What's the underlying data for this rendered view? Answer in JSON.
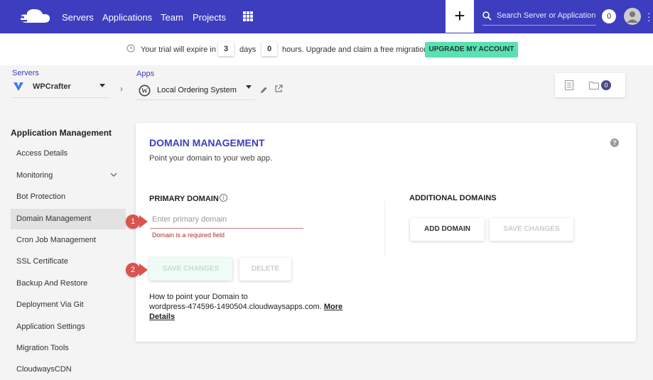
{
  "nav": {
    "links": [
      "Servers",
      "Applications",
      "Team",
      "Projects"
    ],
    "plus_label": "+",
    "search_placeholder": "Search Server or Application",
    "notif_count": "0",
    "brand_color": "#3d3dbf"
  },
  "trial": {
    "text1": "Your trial will expire in",
    "days": "3",
    "text2": "days",
    "hours": "0",
    "text3": "hours. Upgrade and claim a free migration",
    "upgrade_label": "UPGRADE MY ACCOUNT"
  },
  "crumbs": {
    "servers_label": "Servers",
    "server_name": "WPCrafter",
    "apps_label": "Apps",
    "app_name": "Local Ordering System"
  },
  "files_count": "0",
  "sidebar": {
    "title": "Application Management",
    "items": [
      "Access Details",
      "Monitoring",
      "Bot Protection",
      "Domain Management",
      "Cron Job Management",
      "SSL Certificate",
      "Backup And Restore",
      "Deployment Via Git",
      "Application Settings",
      "Migration Tools",
      "CloudwaysCDN"
    ]
  },
  "panel": {
    "title": "DOMAIN MANAGEMENT",
    "subtitle": "Point your domain to your web app.",
    "help": "?",
    "primary_label": "PRIMARY DOMAIN",
    "primary_info": "i",
    "primary_placeholder": "Enter primary domain",
    "primary_error": "Domain is a required field",
    "save_label": "SAVE CHANGES",
    "delete_label": "DELETE",
    "additional_label": "ADDITIONAL DOMAINS",
    "add_domain_label": "ADD DOMAIN",
    "save_right_label": "SAVE CHANGES",
    "howto_line1": "How to point your Domain to",
    "howto_line2": "wordpress-474596-1490504.cloudwaysapps.com.",
    "howto_more": "More",
    "howto_details": "Details"
  },
  "markers": [
    "1",
    "2"
  ]
}
